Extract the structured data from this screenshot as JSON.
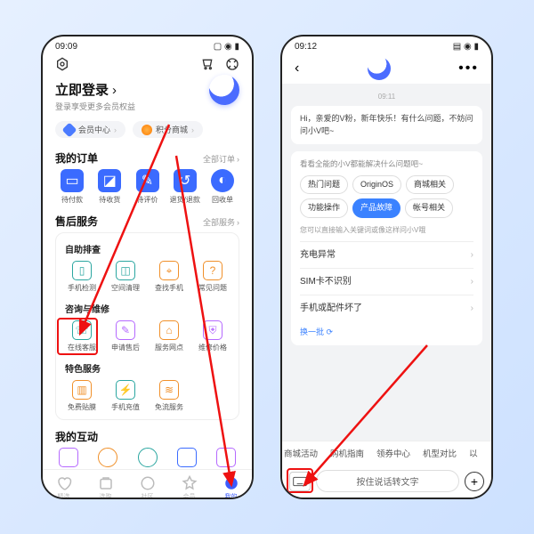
{
  "left": {
    "status_time": "09:09",
    "login_title": "立即登录",
    "login_sub": "登录享受更多会员权益",
    "pills": [
      "会员中心",
      "积分商城"
    ],
    "orders_title": "我的订单",
    "orders_all": "全部订单",
    "orders": [
      "待付款",
      "待收货",
      "待评价",
      "退货/退款",
      "回收单"
    ],
    "after_title": "售后服务",
    "after_all": "全部服务",
    "self_title": "自助排查",
    "self": [
      "手机检测",
      "空间清理",
      "查找手机",
      "常见问题"
    ],
    "consult_title": "咨询与维修",
    "consult": [
      "在线客服",
      "申请售后",
      "服务网点",
      "维修价格"
    ],
    "special_title": "特色服务",
    "special": [
      "免费贴膜",
      "手机充值",
      "免流服务"
    ],
    "interact_title": "我的互动",
    "nav": [
      "精选",
      "选购",
      "社区",
      "会员",
      "我的"
    ]
  },
  "right": {
    "status_time": "09:12",
    "msg_time": "09:11",
    "greeting": "Hi，亲爱的V粉，新年快乐！有什么问题，不妨问问小V吧~",
    "filter_hint": "看看全能的小V都能解决什么问题吧~",
    "filters": [
      "热门问题",
      "OriginOS",
      "商城相关",
      "功能操作",
      "产品故障",
      "帐号相关"
    ],
    "filter_active_index": 4,
    "quick_hint": "您可以直接输入关键词或像这样问小V哦",
    "quicks": [
      "充电异常",
      "SIM卡不识别",
      "手机或配件坏了"
    ],
    "refresh": "换一批",
    "tags": [
      "商城活动",
      "购机指南",
      "领券中心",
      "机型对比",
      "以"
    ],
    "hold_talk": "按住说话转文字"
  }
}
